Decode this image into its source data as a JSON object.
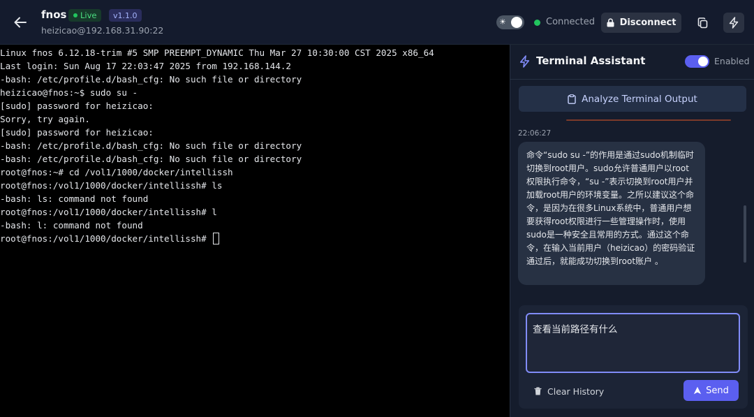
{
  "header": {
    "host_name": "fnos",
    "live_label": "Live",
    "version": "v1.1.0",
    "host_address": "heizicao@192.168.31.90:22",
    "connection_status": "Connected",
    "disconnect_label": "Disconnect"
  },
  "terminal": {
    "lines": [
      "Linux fnos 6.12.18-trim #5 SMP PREEMPT_DYNAMIC Thu Mar 27 10:30:00 CST 2025 x86_64",
      "Last login: Sun Aug 17 22:03:47 2025 from 192.168.144.2",
      "-bash: /etc/profile.d/bash_cfg: No such file or directory",
      "heizicao@fnos:~$ sudo su -",
      "[sudo] password for heizicao:",
      "Sorry, try again.",
      "[sudo] password for heizicao:",
      "-bash: /etc/profile.d/bash_cfg: No such file or directory",
      "-bash: /etc/profile.d/bash_cfg: No such file or directory",
      "root@fnos:~# cd /vol1/1000/docker/intellissh",
      "root@fnos:/vol1/1000/docker/intellissh# ls",
      "-bash: ls: command not found",
      "root@fnos:/vol1/1000/docker/intellissh# l",
      "-bash: l: command not found"
    ],
    "prompt": "root@fnos:/vol1/1000/docker/intellissh# "
  },
  "assistant": {
    "title": "Terminal Assistant",
    "enabled_label": "Enabled",
    "analyze_label": "Analyze Terminal Output",
    "message_time": "22:06:27",
    "message_text": "命令“sudo su -”的作用是通过sudo机制临时切换到root用户。sudo允许普通用户以root权限执行命令，“su -”表示切换到root用户并加载root用户的环境变量。之所以建议这个命令，是因为在很多Linux系统中，普通用户想要获得root权限进行一些管理操作时，使用sudo是一种安全且常用的方式。通过这个命令，在输入当前用户（heizicao）的密码验证通过后，就能成功切换到root账户 。",
    "input_value": "查看当前路径有什么",
    "clear_label": "Clear History",
    "send_label": "Send"
  },
  "colors": {
    "accent": "#5b5ff0",
    "connected": "#22c55e",
    "panel_bg": "#151c2c",
    "header_bg": "#141b2d"
  }
}
